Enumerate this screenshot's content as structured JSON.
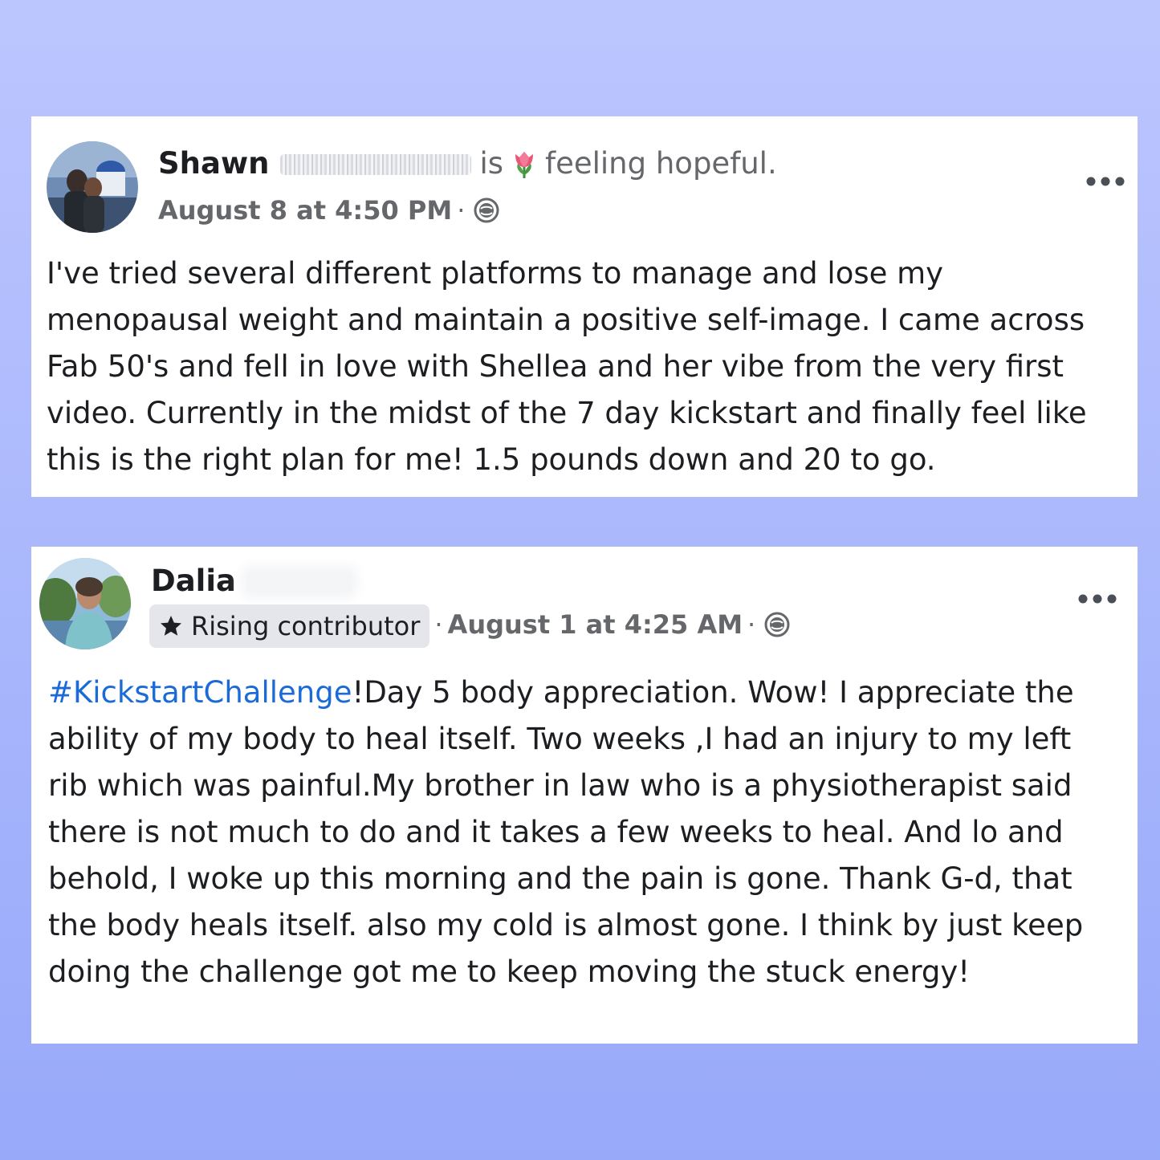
{
  "posts": [
    {
      "author": "Shawn",
      "status_prefix": "is",
      "feeling": "feeling hopeful.",
      "feeling_icon": "tulip-icon",
      "timestamp": "August 8 at 4:50 PM",
      "separator": "·",
      "privacy_icon": "globe-icon",
      "menu_icon": "more-options-icon",
      "body_lines": [
        "I've tried several different platforms to manage and lose my",
        "menopausal weight and maintain a positive self-image. I came across",
        "Fab 50's and fell in love with Shellea and her vibe from the very first",
        "video. Currently in the midst of the 7 day kickstart and finally feel like",
        "this is the right plan for me! 1.5 pounds down and 20 to go."
      ]
    },
    {
      "author": "Dalia",
      "badge": "Rising contributor",
      "badge_icon": "star-icon",
      "timestamp": "August 1 at 4:25 AM",
      "separator": "·",
      "privacy_icon": "globe-icon",
      "menu_icon": "more-options-icon",
      "hashtag": "#KickstartChallenge",
      "body_lines": [
        "!Day 5 body appreciation. Wow! I appreciate the",
        "ability of my body to heal itself. Two weeks ,I had an injury to my left",
        "rib which was painful.My brother in law who is a physiotherapist said",
        "there is not much to do and it takes a few weeks to heal. And lo and",
        "behold, I woke up this morning and the pain is gone. Thank G-d, that",
        "the body heals itself. also my cold is almost gone. I think by just keep",
        "doing the challenge got me to keep moving the stuck energy!"
      ]
    }
  ],
  "colors": {
    "background_top": "#bcc6fe",
    "background_bottom": "#98a9fa",
    "card": "#ffffff",
    "text": "#1c1e21",
    "secondary_text": "#65676b",
    "hashtag": "#1a6bd8",
    "badge_bg": "#e4e6eb"
  }
}
